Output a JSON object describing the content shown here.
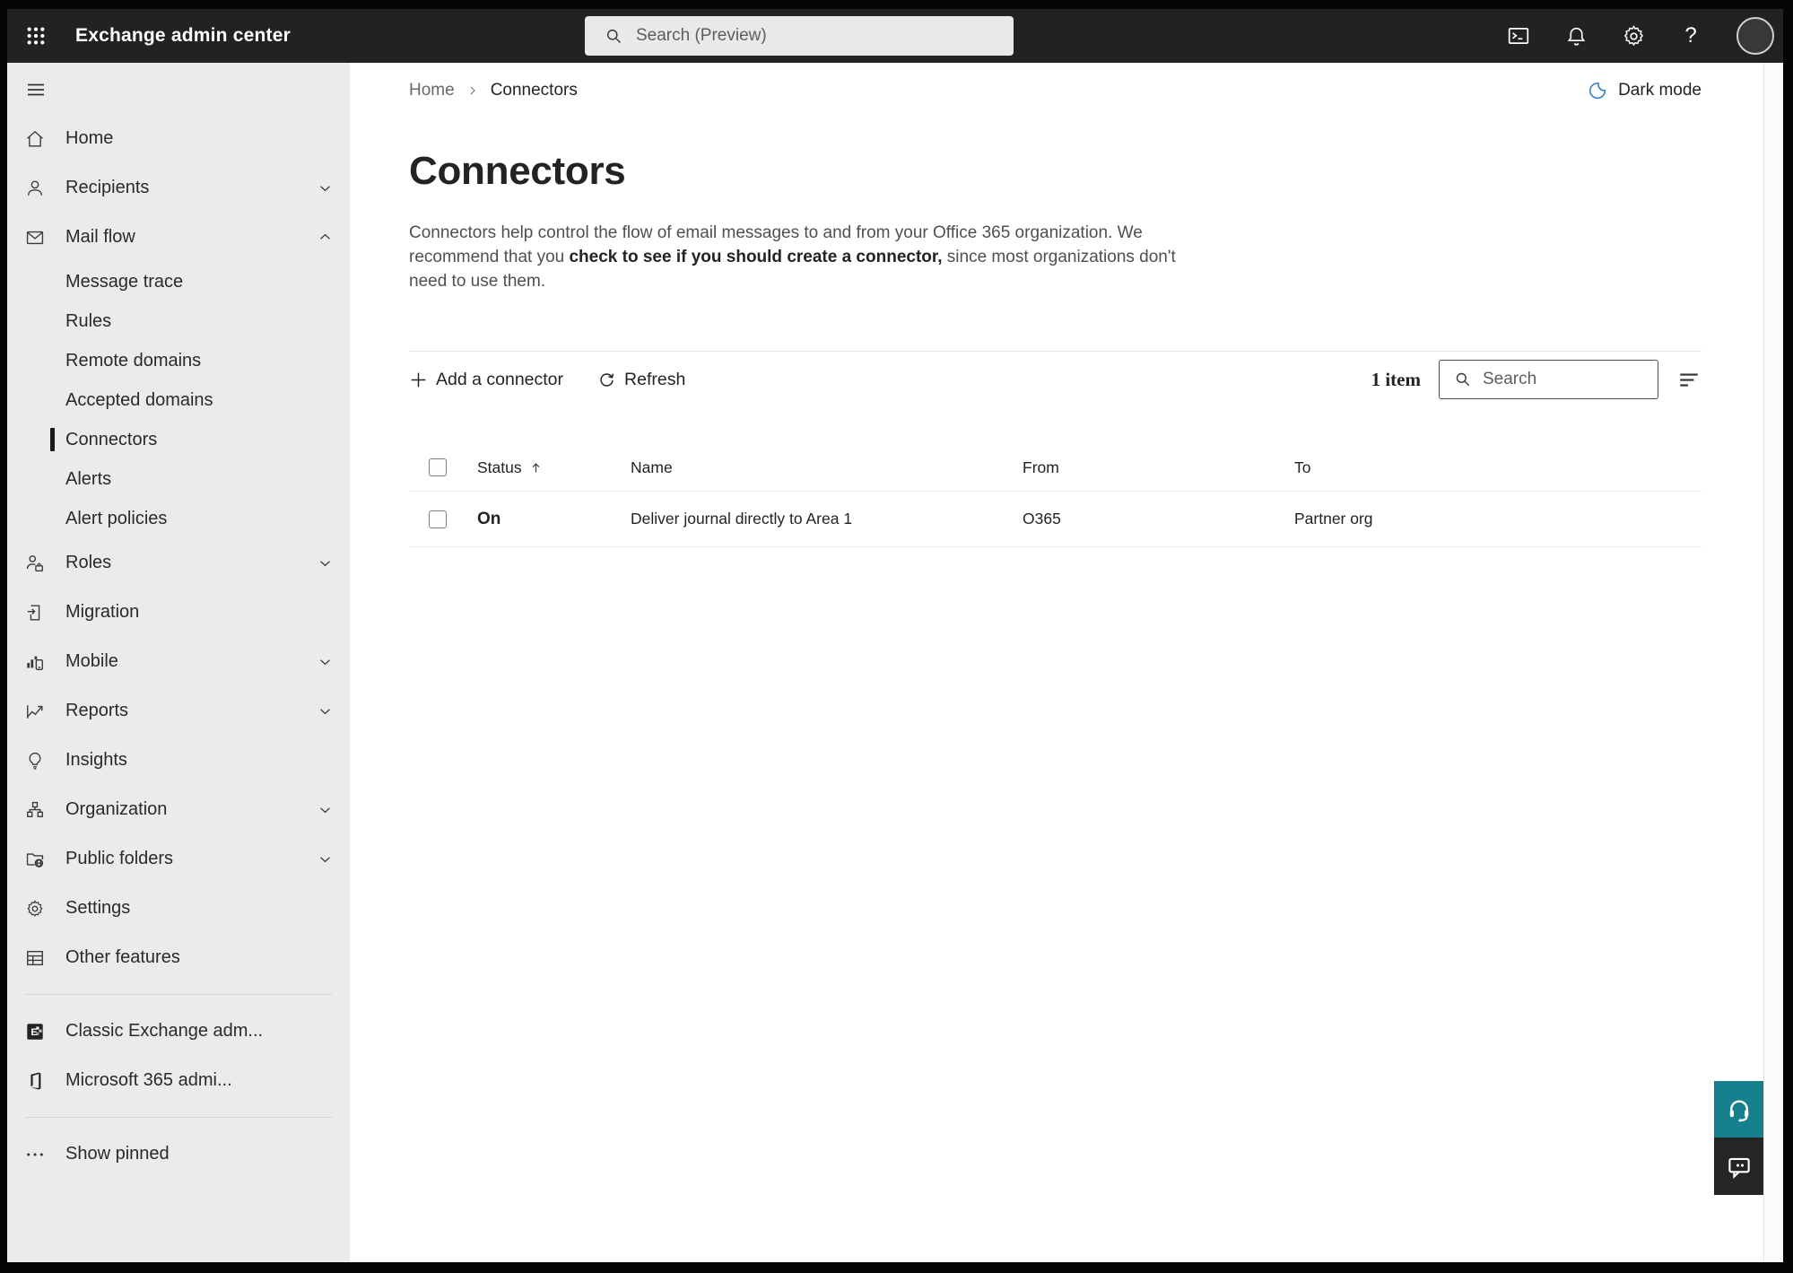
{
  "topbar": {
    "app_title": "Exchange admin center",
    "search_placeholder": "Search (Preview)"
  },
  "sidebar": {
    "items": [
      {
        "label": "Home"
      },
      {
        "label": "Recipients"
      },
      {
        "label": "Mail flow"
      },
      {
        "label": "Message trace"
      },
      {
        "label": "Rules"
      },
      {
        "label": "Remote domains"
      },
      {
        "label": "Accepted domains"
      },
      {
        "label": "Connectors"
      },
      {
        "label": "Alerts"
      },
      {
        "label": "Alert policies"
      },
      {
        "label": "Roles"
      },
      {
        "label": "Migration"
      },
      {
        "label": "Mobile"
      },
      {
        "label": "Reports"
      },
      {
        "label": "Insights"
      },
      {
        "label": "Organization"
      },
      {
        "label": "Public folders"
      },
      {
        "label": "Settings"
      },
      {
        "label": "Other features"
      },
      {
        "label": "Classic Exchange adm..."
      },
      {
        "label": "Microsoft 365 admi..."
      },
      {
        "label": "Show pinned"
      }
    ]
  },
  "header": {
    "breadcrumb": {
      "home": "Home",
      "current": "Connectors"
    },
    "dark_mode_label": "Dark mode"
  },
  "page": {
    "title": "Connectors",
    "description": {
      "before_link": "Connectors help control the flow of email messages to and from your Office 365 organization. We recommend that you ",
      "link": "check to see if you should create a connector,",
      "after_link": " since most organizations don't need to use them."
    }
  },
  "toolbar": {
    "add_button": "Add a connector",
    "refresh_button": "Refresh",
    "item_count": "1 item",
    "search_placeholder": "Search"
  },
  "table": {
    "columns": {
      "status": "Status",
      "name": "Name",
      "from": "From",
      "to": "To"
    },
    "rows": [
      {
        "status": "On",
        "name": "Deliver journal directly to Area 1",
        "from": "O365",
        "to": "Partner org"
      }
    ]
  },
  "colors": {
    "topbar_bg": "#232221",
    "sidebar_bg": "#ebebeb",
    "accent_teal": "#16808d",
    "moon_blue": "#2b7cd3",
    "chat_button_bg": "#262524",
    "text_dark": "#242322",
    "text_gray": "#514f4d"
  }
}
